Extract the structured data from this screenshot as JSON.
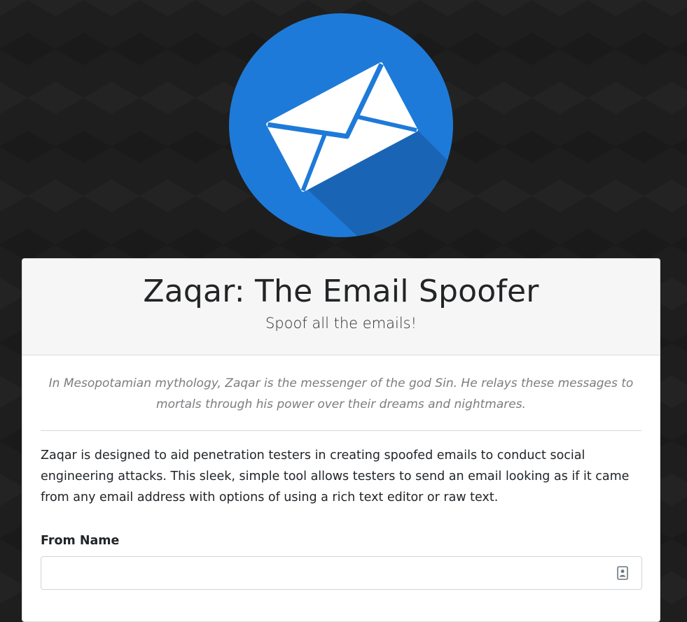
{
  "header": {
    "title": "Zaqar: The Email Spoofer",
    "subtitle": "Spoof all the emails!"
  },
  "logo": {
    "icon": "envelope-icon",
    "circle_color": "#1e7ad8",
    "shadow_color": "#1a64b5",
    "envelope_color": "#ffffff"
  },
  "body": {
    "quote": "In Mesopotamian mythology, Zaqar is the messenger of the god Sin. He relays these messages to mortals through his power over their dreams and nightmares.",
    "intro": "Zaqar is designed to aid penetration testers in creating spoofed emails to conduct social engineering attacks. This sleek, simple tool allows testers to send an email looking as if it came from any email address with options of using a rich text editor or raw text."
  },
  "form": {
    "from_name": {
      "label": "From Name",
      "value": "",
      "placeholder": "",
      "icon": "contact-card-icon"
    }
  }
}
